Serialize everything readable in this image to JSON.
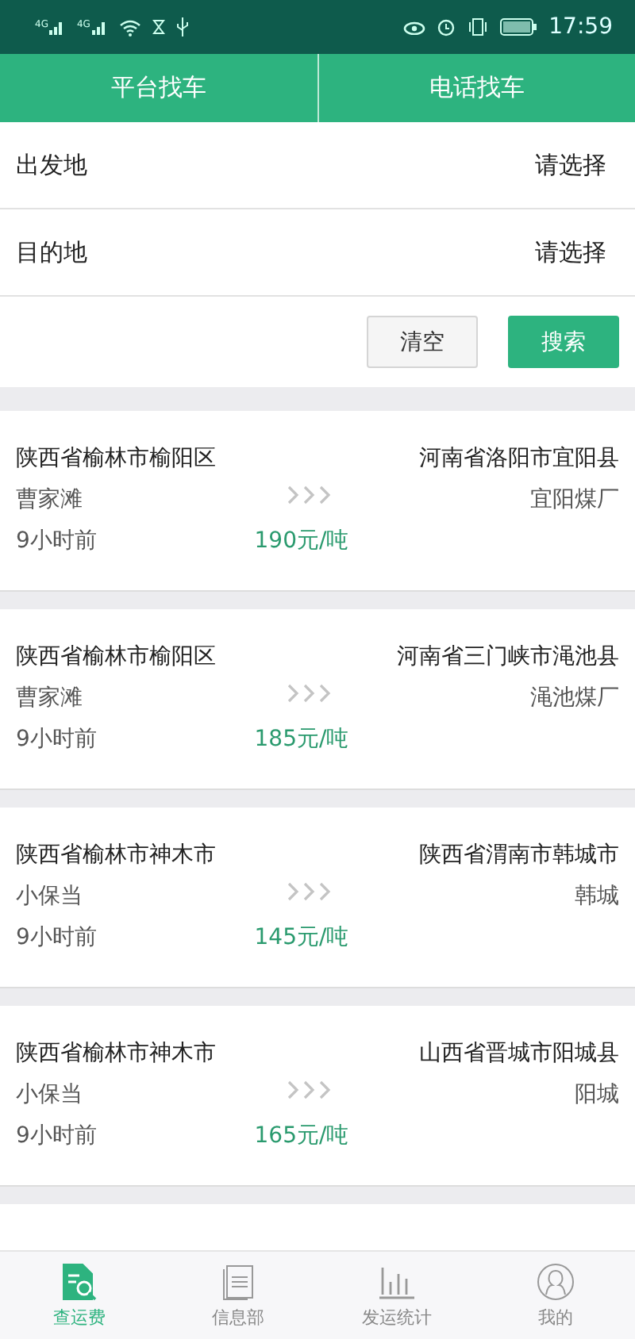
{
  "status_bar": {
    "network_labels": [
      "4G",
      "4G"
    ],
    "time": "17:59"
  },
  "tabs": [
    {
      "label": "平台找车",
      "selected": false
    },
    {
      "label": "电话找车",
      "selected": false
    }
  ],
  "form": {
    "rows": [
      {
        "label": "出发地",
        "value": "请选择"
      },
      {
        "label": "目的地",
        "value": "请选择"
      }
    ],
    "buttons": [
      {
        "label": "清空",
        "kind": "secondary"
      },
      {
        "label": "搜索",
        "kind": "primary"
      }
    ]
  },
  "routes": [
    {
      "from": "陕西省榆林市榆阳区",
      "from_place": "曹家滩",
      "time": "9小时前",
      "to": "河南省洛阳市宜阳县",
      "to_place": "宜阳煤厂",
      "price": "190元/吨"
    },
    {
      "from": "陕西省榆林市榆阳区",
      "from_place": "曹家滩",
      "time": "9小时前",
      "to": "河南省三门峡市渑池县",
      "to_place": "渑池煤厂",
      "price": "185元/吨"
    },
    {
      "from": "陕西省榆林市神木市",
      "from_place": "小保当",
      "time": "9小时前",
      "to": "陕西省渭南市韩城市",
      "to_place": "韩城",
      "price": "145元/吨"
    },
    {
      "from": "陕西省榆林市神木市",
      "from_place": "小保当",
      "time": "9小时前",
      "to": "山西省晋城市阳城县",
      "to_place": "阳城",
      "price": "165元/吨"
    }
  ],
  "bottom_nav": [
    {
      "label": "查运费",
      "selected": true,
      "kind": "fare"
    },
    {
      "label": "信息部",
      "selected": false,
      "kind": "info"
    },
    {
      "label": "发运统计",
      "selected": false,
      "kind": "stats"
    },
    {
      "label": "我的",
      "selected": false,
      "kind": "profile"
    }
  ]
}
